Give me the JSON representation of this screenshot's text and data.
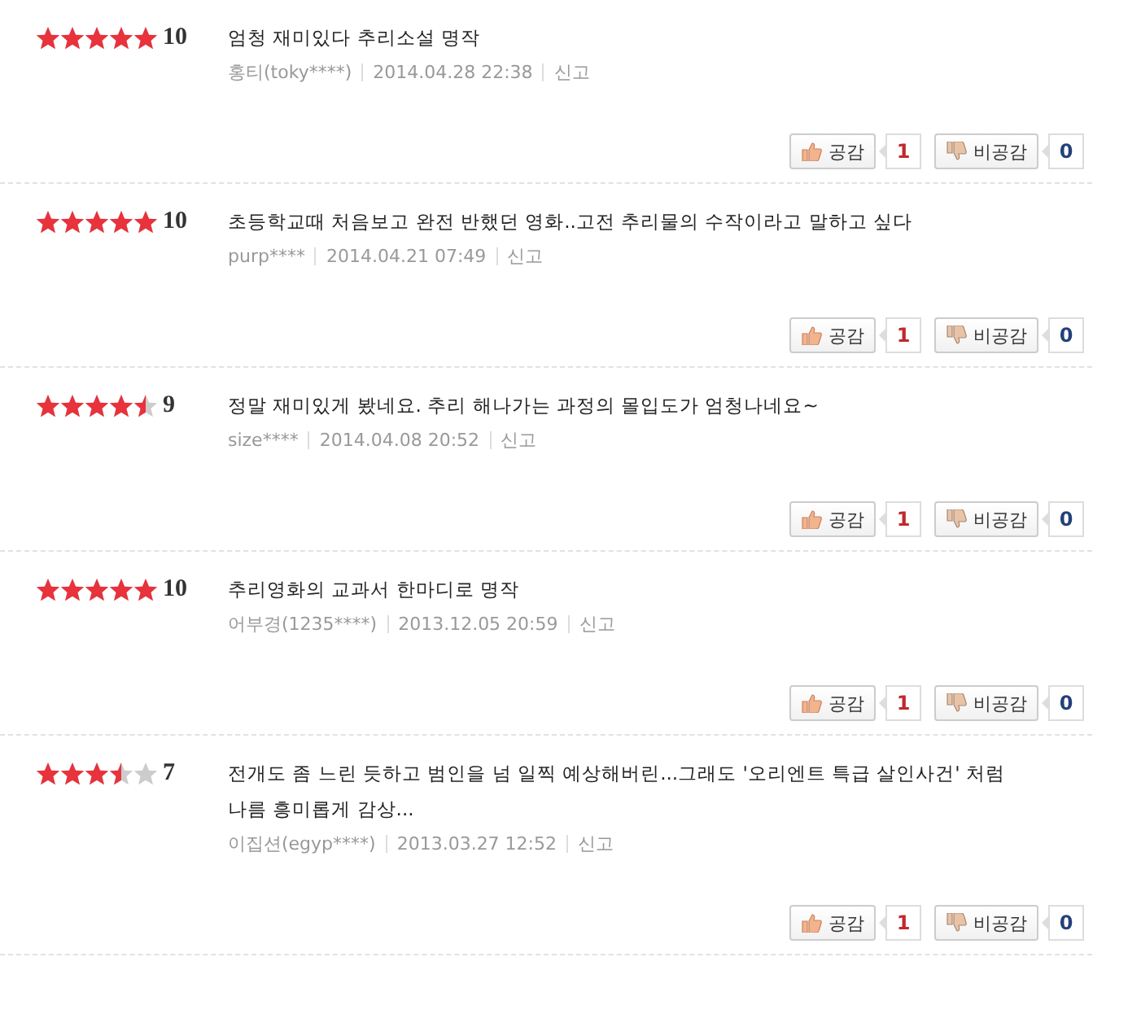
{
  "reviews": [
    {
      "stars": 5,
      "score": "10",
      "text": "엄청 재미있다 추리소설 명작",
      "author": "홍티(toky****)",
      "date": "2014.04.28 22:38",
      "report": "신고",
      "like_label": "공감",
      "like_count": "1",
      "dislike_label": "비공감",
      "dislike_count": "0"
    },
    {
      "stars": 5,
      "score": "10",
      "text": "초등학교때 처음보고 완전 반했던 영화..고전 추리물의 수작이라고 말하고 싶다",
      "author": "purp****",
      "date": "2014.04.21 07:49",
      "report": "신고",
      "like_label": "공감",
      "like_count": "1",
      "dislike_label": "비공감",
      "dislike_count": "0"
    },
    {
      "stars": 4.5,
      "score": "9",
      "text": "정말 재미있게 봤네요. 추리 해나가는 과정의 몰입도가 엄청나네요~",
      "author": "size****",
      "date": "2014.04.08 20:52",
      "report": "신고",
      "like_label": "공감",
      "like_count": "1",
      "dislike_label": "비공감",
      "dislike_count": "0"
    },
    {
      "stars": 5,
      "score": "10",
      "text": "추리영화의 교과서 한마디로 명작",
      "author": "어부경(1235****)",
      "date": "2013.12.05 20:59",
      "report": "신고",
      "like_label": "공감",
      "like_count": "1",
      "dislike_label": "비공감",
      "dislike_count": "0"
    },
    {
      "stars": 3.5,
      "score": "7",
      "text": "전개도 좀 느린 듯하고 범인을 넘 일찍 예상해버린...그래도 '오리엔트 특급 살인사건' 처럼 나름 흥미롭게 감상...",
      "author": "이집션(egyp****)",
      "date": "2013.03.27 12:52",
      "report": "신고",
      "like_label": "공감",
      "like_count": "1",
      "dislike_label": "비공감",
      "dislike_count": "0"
    }
  ]
}
